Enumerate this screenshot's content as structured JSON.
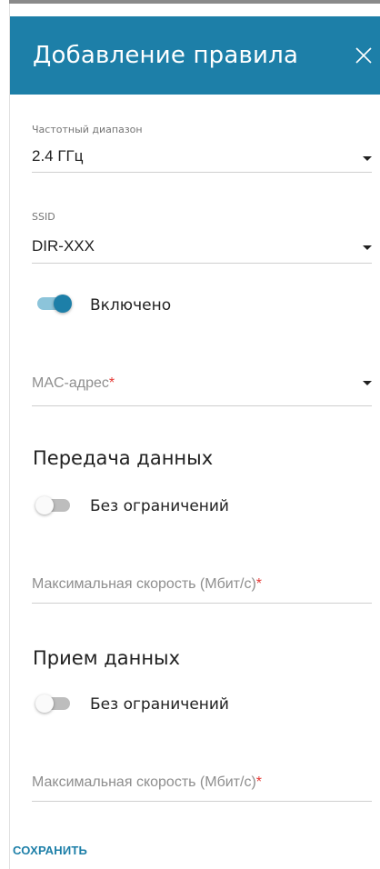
{
  "dialog": {
    "title": "Добавление правила",
    "close_icon": "close-icon"
  },
  "frequency": {
    "label": "Частотный диапазон",
    "value": "2.4 ГГц"
  },
  "ssid": {
    "label": "SSID",
    "value": "DIR-XXX"
  },
  "enabled": {
    "label": "Включено",
    "state": true
  },
  "mac": {
    "placeholder": "MAC-адрес",
    "required_mark": "*"
  },
  "upload": {
    "title": "Передача данных",
    "unlimited_label": "Без ограничений",
    "unlimited_state": false,
    "max_speed_placeholder": "Максимальная скорость (Мбит/с)",
    "required_mark": "*"
  },
  "download": {
    "title": "Прием данных",
    "unlimited_label": "Без ограничений",
    "unlimited_state": false,
    "max_speed_placeholder": "Максимальная скорость (Мбит/с)",
    "required_mark": "*"
  },
  "actions": {
    "save_label": "СОХРАНИТЬ"
  },
  "colors": {
    "accent": "#1d7fa8",
    "required": "#e53935"
  }
}
